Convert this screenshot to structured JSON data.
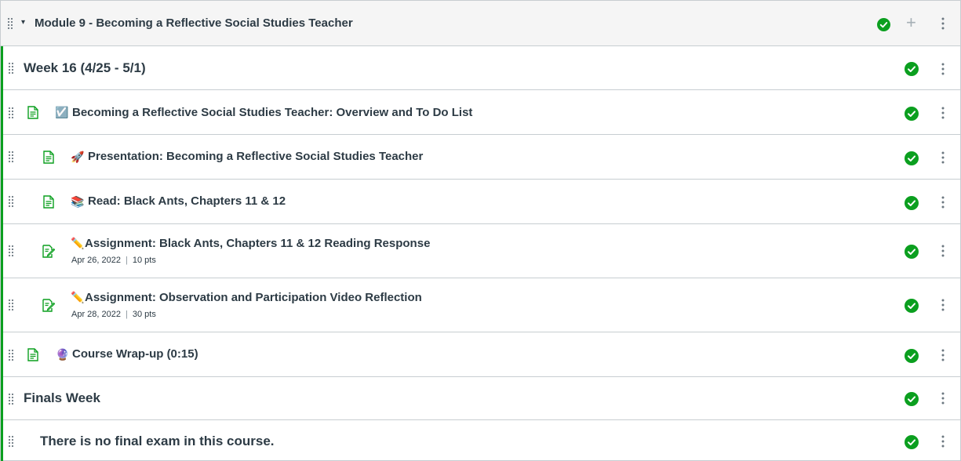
{
  "module": {
    "title": "Module 9 - Becoming a Reflective Social Studies Teacher",
    "collapse_indicator": "▾",
    "add_label": "+",
    "status": "completed"
  },
  "items": [
    {
      "kind": "header",
      "title": "Week 16 (4/25 - 5/1)"
    },
    {
      "kind": "page",
      "emoji": "☑️",
      "title": "Becoming a Reflective Social Studies Teacher: Overview and To Do List"
    },
    {
      "kind": "page",
      "emoji": "🚀",
      "title": "Presentation: Becoming a Reflective Social Studies Teacher"
    },
    {
      "kind": "page",
      "emoji": "📚",
      "title": "Read: Black Ants, Chapters 11 & 12"
    },
    {
      "kind": "assignment",
      "emoji": "✏️",
      "title": "Assignment: Black Ants, Chapters 11 & 12 Reading Response",
      "due": "Apr 26, 2022",
      "sep": "|",
      "points": "10 pts"
    },
    {
      "kind": "assignment",
      "emoji": "✏️",
      "title": "Assignment: Observation and Participation Video Reflection",
      "due": "Apr 28, 2022",
      "sep": "|",
      "points": "30 pts"
    },
    {
      "kind": "page",
      "emoji": "🔮",
      "title": "Course Wrap-up (0:15)"
    },
    {
      "kind": "header",
      "title": "Finals Week"
    },
    {
      "kind": "text",
      "title": "There is no final exam in this course."
    }
  ],
  "colors": {
    "complete_green": "#0b9f1f",
    "border_green": "#0b9f1f",
    "text": "#2d3b45",
    "header_bg": "#f5f5f5"
  },
  "icons": {
    "drag": "drag-handle-icon",
    "check": "check-circle-icon",
    "more": "kebab-menu-icon",
    "page": "page-document-icon",
    "assignment": "assignment-edit-icon"
  }
}
